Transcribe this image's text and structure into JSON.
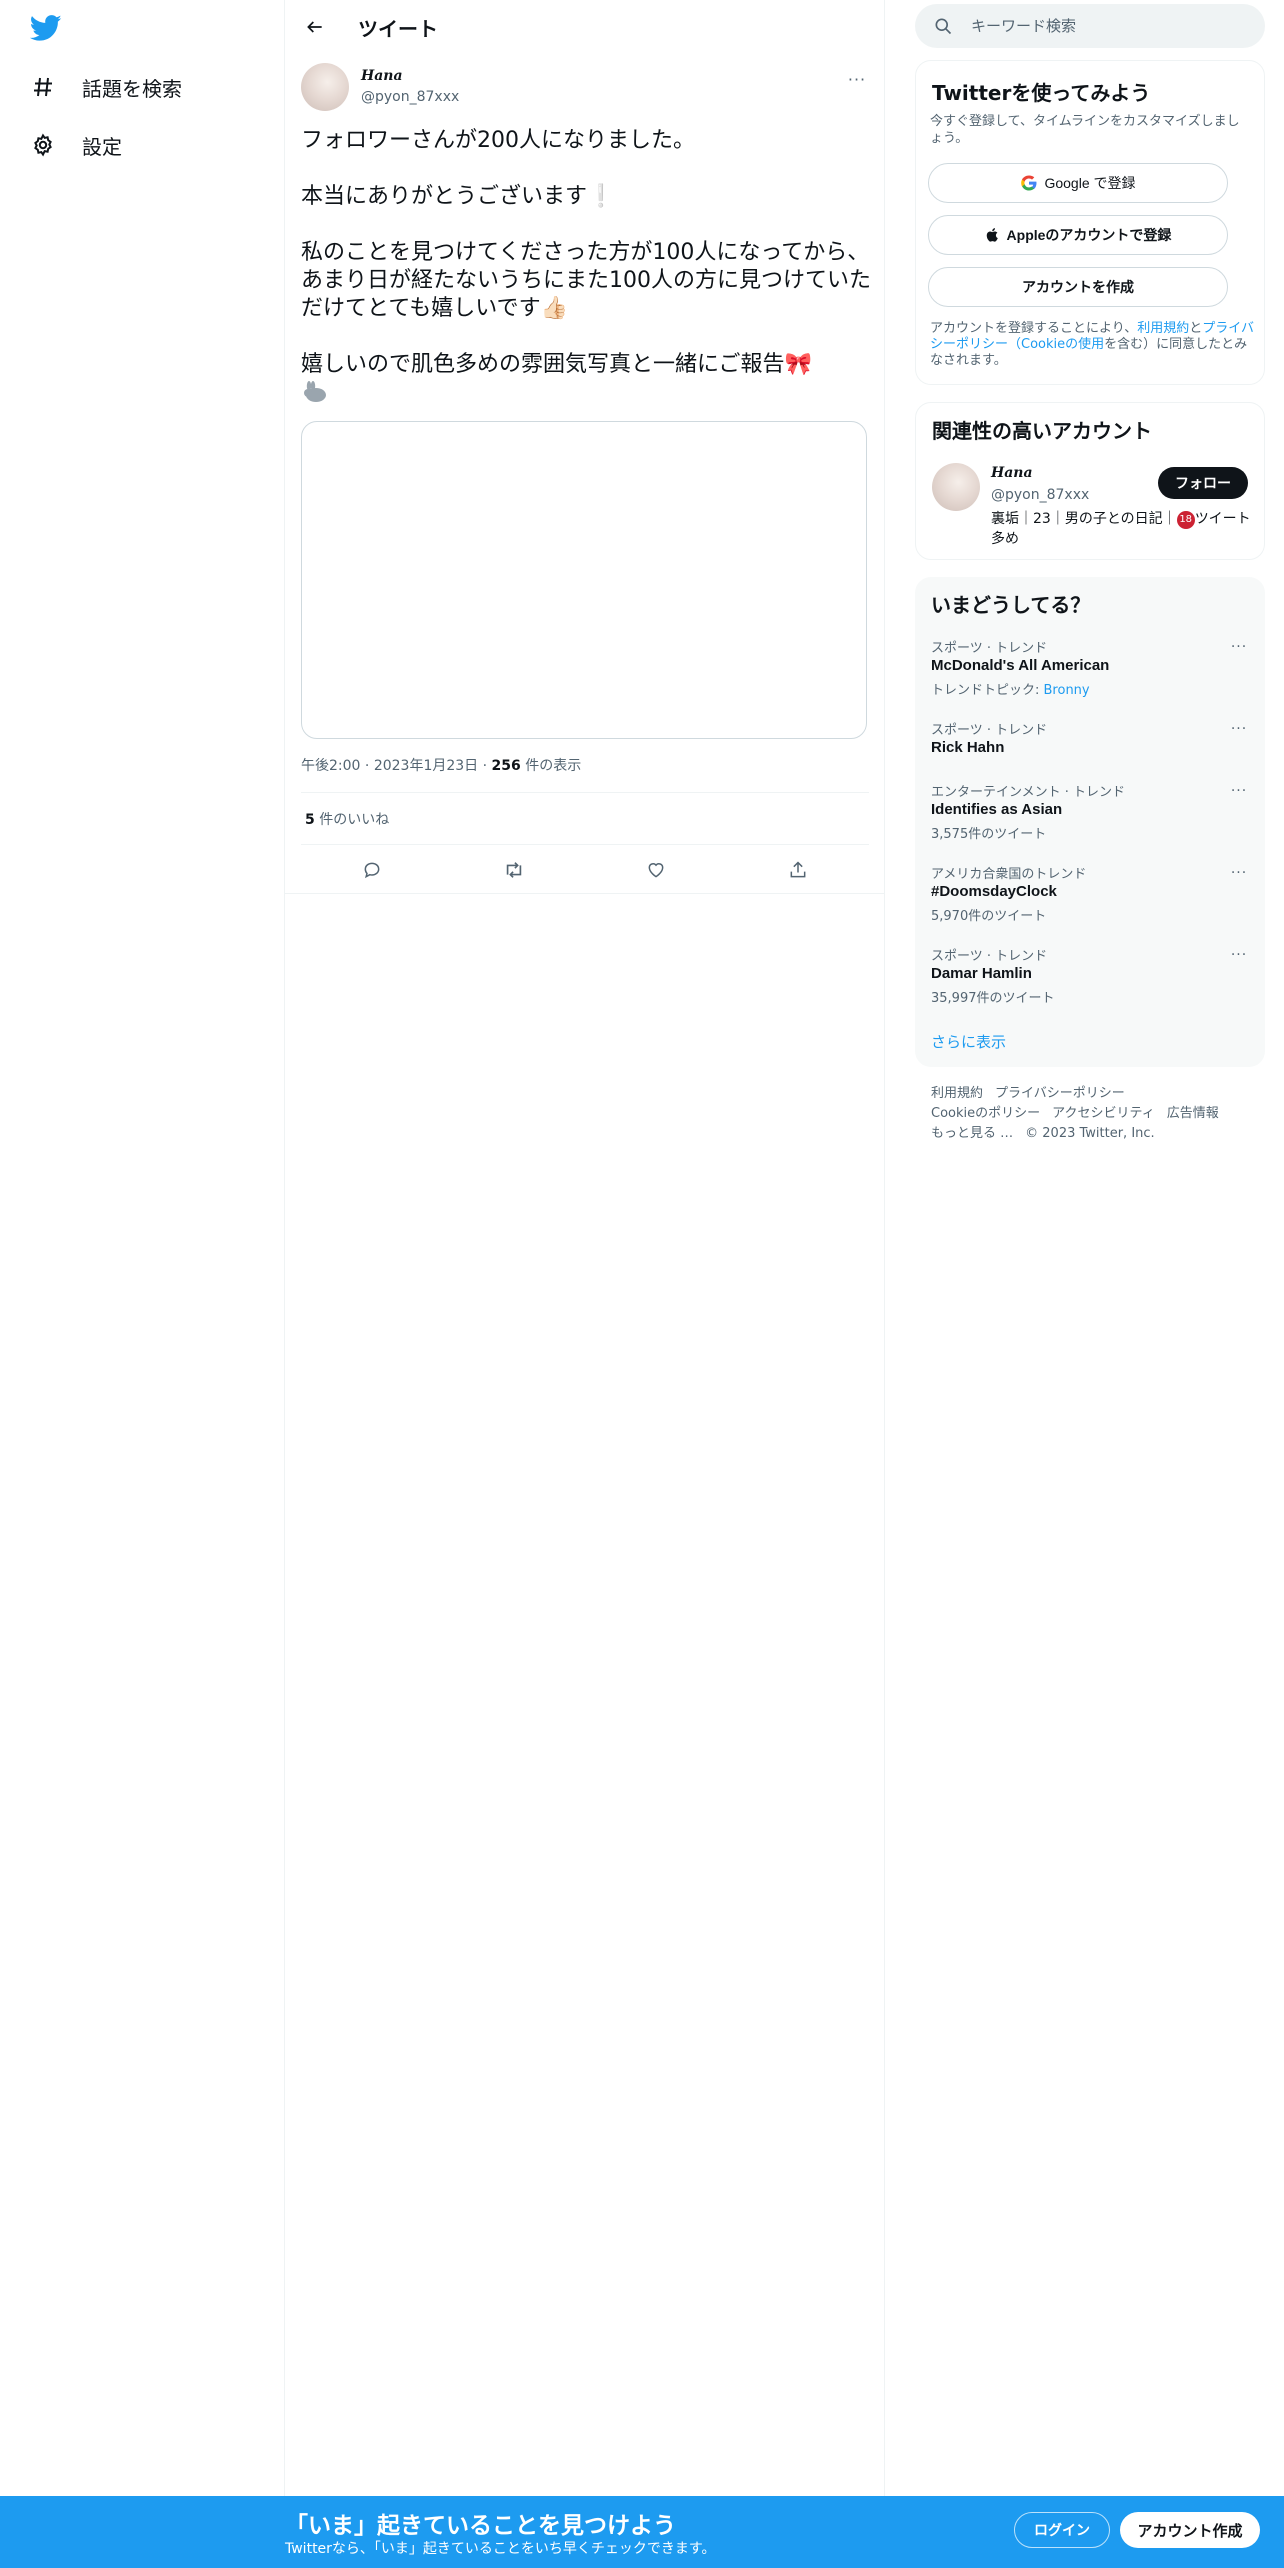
{
  "nav": {
    "logo_icon": "twitter-bird-icon",
    "items": [
      {
        "label": "話題を検索",
        "icon": "hashtag-icon"
      },
      {
        "label": "設定",
        "icon": "gear-icon"
      }
    ]
  },
  "header": {
    "title": "ツイート",
    "back_icon": "arrow-left-icon"
  },
  "tweet": {
    "display_name": "𝑯𝒂𝒏𝒂",
    "handle": "@pyon_87xxx",
    "paragraphs": [
      "フォロワーさんが200人になりました。",
      "本当にありがとうございます❕",
      "私のことを見つけてくださった方が100人になってから、あまり日が経たないうちにまた100人の方に見つけていただけてとても嬉しいです👍🏻",
      "嬉しいので肌色多めの雰囲気写真と一緒にご報告🎀"
    ],
    "time": "午後2:00",
    "date": "2023年1月23日",
    "views_count": "256",
    "views_label": " 件の表示",
    "likes_count": "5",
    "likes_label": " 件のいいね"
  },
  "search": {
    "placeholder": "キーワード検索"
  },
  "signup": {
    "title": "Twitterを使ってみよう",
    "subtitle": "今すぐ登録して、タイムラインをカスタマイズしましょう。",
    "google_label": "Google で登録",
    "apple_label": "Appleのアカウントで登録",
    "create_label": "アカウントを作成",
    "legal_pre": "アカウントを登録することにより、",
    "legal_terms": "利用規約",
    "legal_and": "と",
    "legal_privacy": "プライバシーポリシー（Cookieの使用",
    "legal_post": "を含む）に同意したとみなされます。"
  },
  "related": {
    "title": "関連性の高いアカウント",
    "name": "𝑯𝒂𝒏𝒂",
    "handle": "@pyon_87xxx",
    "follow_label": "フォロー",
    "bio_pre": "裏垢｜23｜男の子との日記｜",
    "bio_badge": "18",
    "bio_post": "ツイート多め"
  },
  "trends": {
    "title": "いまどうしてる？",
    "items": [
      {
        "context": "スポーツ · トレンド",
        "name": "McDonald's All American",
        "sub_pre": "トレンドトピック: ",
        "sub_link": "Bronny"
      },
      {
        "context": "スポーツ · トレンド",
        "name": "Rick Hahn",
        "sub_pre": "",
        "sub_link": ""
      },
      {
        "context": "エンターテインメント · トレンド",
        "name": "Identifies as Asian",
        "sub_pre": "3,575件のツイート",
        "sub_link": ""
      },
      {
        "context": "アメリカ合衆国のトレンド",
        "name": "#DoomsdayClock",
        "sub_pre": "5,970件のツイート",
        "sub_link": ""
      },
      {
        "context": "スポーツ · トレンド",
        "name": "Damar Hamlin",
        "sub_pre": "35,997件のツイート",
        "sub_link": ""
      }
    ],
    "show_more": "さらに表示"
  },
  "footer": {
    "links": [
      "利用規約",
      "プライバシーポリシー",
      "Cookieのポリシー",
      "アクセシビリティ",
      "広告情報",
      "もっと見る …",
      "© 2023 Twitter, Inc."
    ]
  },
  "banner": {
    "title": "「いま」起きていることを見つけよう",
    "subtitle": "Twitterなら、「いま」起きていることをいち早くチェックできます。",
    "login_label": "ログイン",
    "signup_label": "アカウント作成"
  },
  "colors": {
    "accent": "#1d9bf0",
    "text": "#0f1419",
    "muted": "#536471"
  }
}
